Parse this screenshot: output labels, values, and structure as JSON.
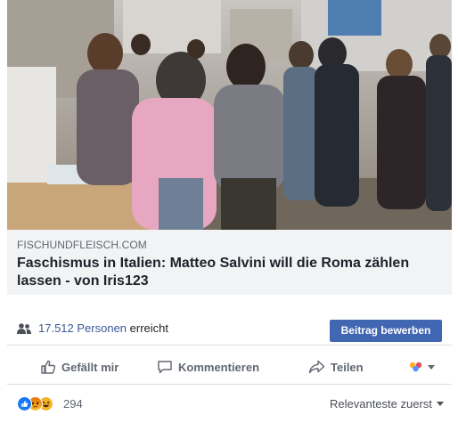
{
  "post": {
    "image_alt": "photo-people-gathered-outdoors",
    "link": {
      "domain": "FISCHUNDFLEISCH.COM",
      "headline": "Faschismus in Italien: Matteo Salvini will die Roma zählen lassen - von Iris123"
    },
    "reach": {
      "icon": "people-icon",
      "count": "17.512 Personen",
      "suffix": "erreicht",
      "promote_label": "Beitrag bewerben"
    },
    "actions": {
      "like_label": "Gefällt mir",
      "comment_label": "Kommentieren",
      "share_label": "Teilen",
      "audience_icon": "audience-selector-icon"
    },
    "reactions": {
      "icons": [
        "like-reaction-icon",
        "angry-reaction-icon",
        "haha-reaction-icon"
      ],
      "count": "294",
      "sort_label": "Relevanteste zuerst"
    }
  },
  "colors": {
    "link_blue": "#385898",
    "button_blue": "#4267b2",
    "muted_text": "#606770",
    "link_box_bg": "#f2f3f5",
    "like_blue": "#1877f2",
    "angry_orange": "#e9710f",
    "haha_yellow": "#f7b125"
  }
}
